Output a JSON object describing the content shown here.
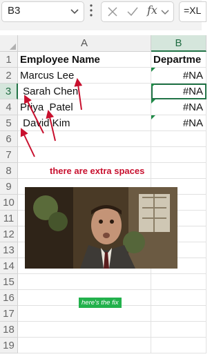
{
  "formula_bar": {
    "name_box": "B3",
    "fx_label": "fx",
    "formula_text": "=XL"
  },
  "columns": {
    "a": "A",
    "b": "B"
  },
  "rows": [
    "1",
    "2",
    "3",
    "4",
    "5",
    "6",
    "7",
    "8",
    "9",
    "10",
    "11",
    "12",
    "13",
    "14",
    "15",
    "16",
    "17",
    "18",
    "19"
  ],
  "sheet": {
    "header_a": "Employee Name",
    "header_b": "Departme",
    "names": [
      "Marcus Lee",
      " Sarah Chen",
      "Priya  Patel",
      " David Kim"
    ],
    "errors": [
      "#NA",
      "#NA",
      "#NA",
      "#NA"
    ]
  },
  "overlay": {
    "annotation": "there are extra spaces",
    "fix_caption": "here's the fix",
    "annotation_color": "#c8102e",
    "badge_color": "#22b14c",
    "accent_green": "#217346"
  }
}
